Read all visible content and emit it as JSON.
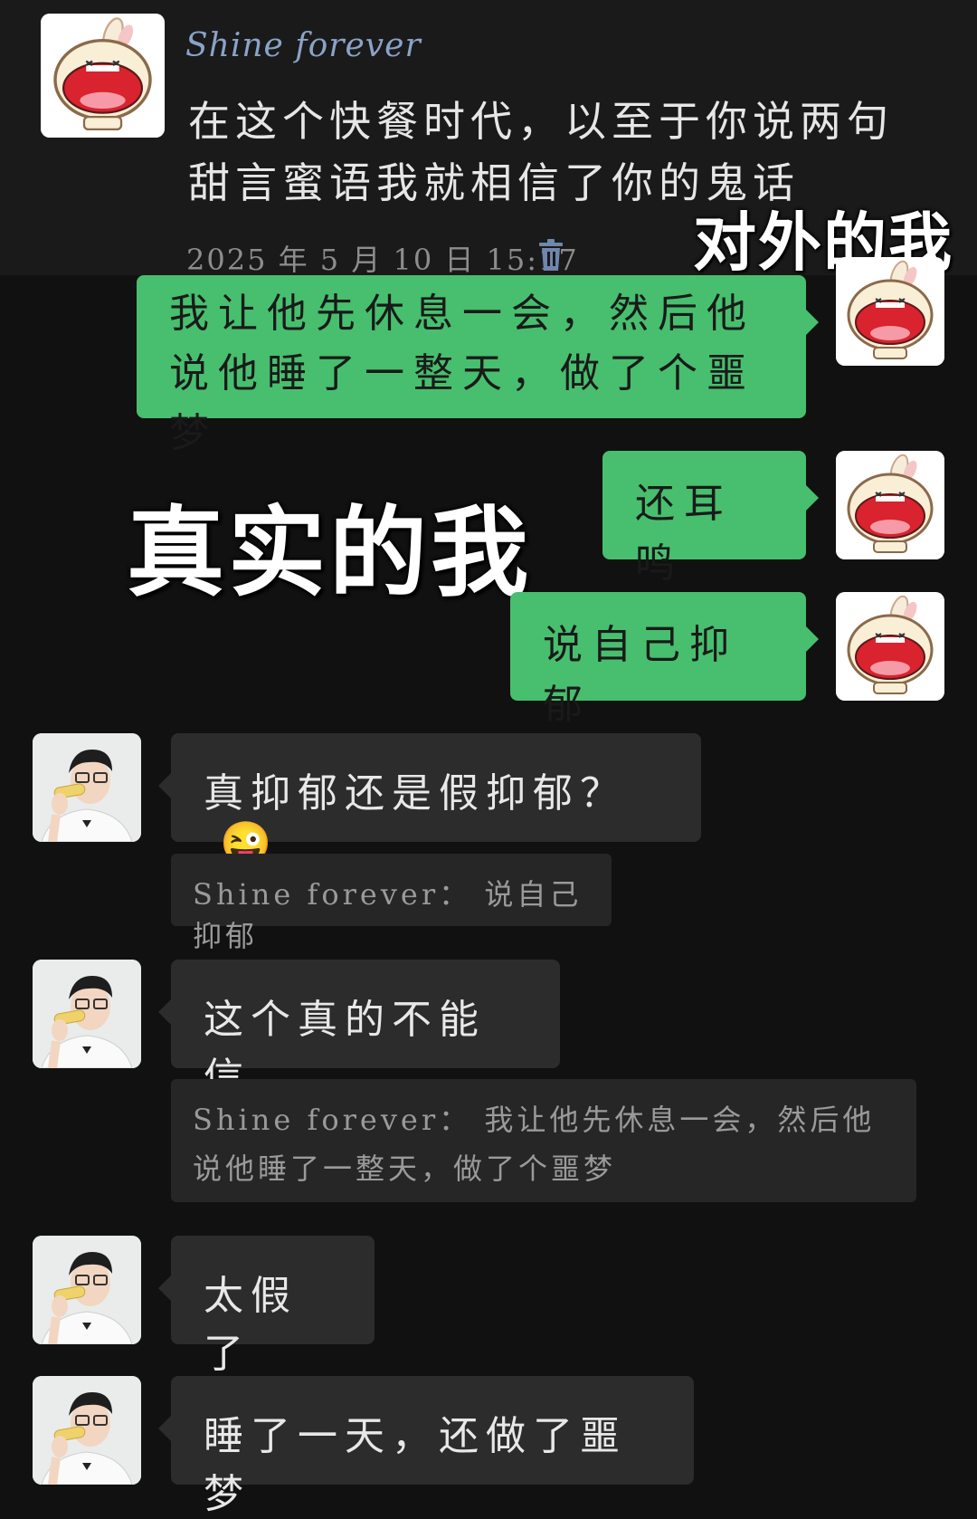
{
  "post": {
    "username": "Shine forever",
    "text": "在这个快餐时代，以至于你说两句甜言蜜语我就相信了你的鬼话",
    "timestamp": "2025 年 5 月 10 日  15:17",
    "delete_icon": "trash-icon"
  },
  "overlays": {
    "top": "对外的我",
    "middle": "真实的我"
  },
  "self_messages": [
    {
      "text": "我让他先休息一会，然后他说他睡了一整天，做了个噩梦"
    },
    {
      "text": "还耳鸣"
    },
    {
      "text": "说自己抑郁"
    }
  ],
  "other_messages": [
    {
      "text": "真抑郁还是假抑郁？",
      "emoji": "😜",
      "quote": "Shine forever：  说自己抑郁"
    },
    {
      "text": "这个真的不能信",
      "quote": "Shine forever：  我让他先休息一会，然后他说他睡了一整天，做了个噩梦"
    },
    {
      "text": "太假了"
    },
    {
      "text": "睡了一天，还做了噩梦"
    }
  ],
  "colors": {
    "background": "#111111",
    "self_bubble": "#47bf6e",
    "other_bubble": "#2c2c2c",
    "quote_bg": "#262626",
    "username": "#8aa3c7"
  }
}
